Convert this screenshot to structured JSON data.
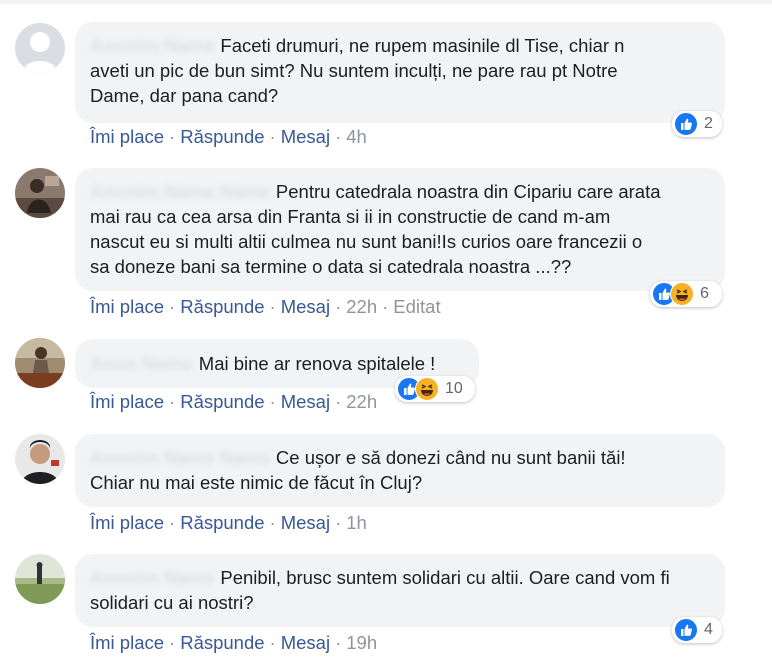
{
  "actions": {
    "like": "Îmi place",
    "reply": "Răspunde",
    "message": "Mesaj",
    "separator": "·",
    "edited": "Editat"
  },
  "colors": {
    "link": "#385898",
    "meta": "#90949c",
    "bubble": "#f2f3f5",
    "like_blue": "#1877f2",
    "haha_yellow": "#f7b125"
  },
  "comments": [
    {
      "avatar": "default-avatar",
      "text_lines": [
        "Faceti drumuri, ne rupem masinile dl Tise, chiar n",
        "aveti un pic de bun simt? Nu suntem inculți, ne pare rau pt Notre",
        "Dame, dar pana cand?"
      ],
      "time": "4h",
      "reactions": [
        "like-icon"
      ],
      "reaction_count": "2"
    },
    {
      "avatar": "user-photo-avatar",
      "text_lines": [
        "Pentru catedrala noastra din Cipariu care arata",
        "mai rau ca cea arsa din Franta si ii in constructie de cand m-am",
        "nascut eu si multi altii culmea nu sunt bani!Is curios oare francezii o",
        "sa doneze bani sa termine o data si catedrala noastra ...??"
      ],
      "time": "22h",
      "edited": true,
      "reactions": [
        "like-icon",
        "haha-icon"
      ],
      "reaction_count": "6"
    },
    {
      "avatar": "user-photo-avatar",
      "text_lines": [
        "Mai bine ar renova spitalele !"
      ],
      "time": "22h",
      "reactions": [
        "like-icon",
        "haha-icon"
      ],
      "reaction_count": "10"
    },
    {
      "avatar": "user-photo-avatar",
      "text_lines": [
        "Ce ușor e să donezi când nu sunt banii tăi!",
        "Chiar nu mai este nimic de făcut în Cluj?"
      ],
      "time": "1h",
      "reactions": [],
      "reaction_count": ""
    },
    {
      "avatar": "user-photo-avatar",
      "text_lines": [
        "Penibil, brusc suntem solidari cu altii. Oare cand vom fi",
        "solidari cu ai nostri?"
      ],
      "time": "19h",
      "reactions": [
        "like-icon"
      ],
      "reaction_count": "4"
    }
  ]
}
